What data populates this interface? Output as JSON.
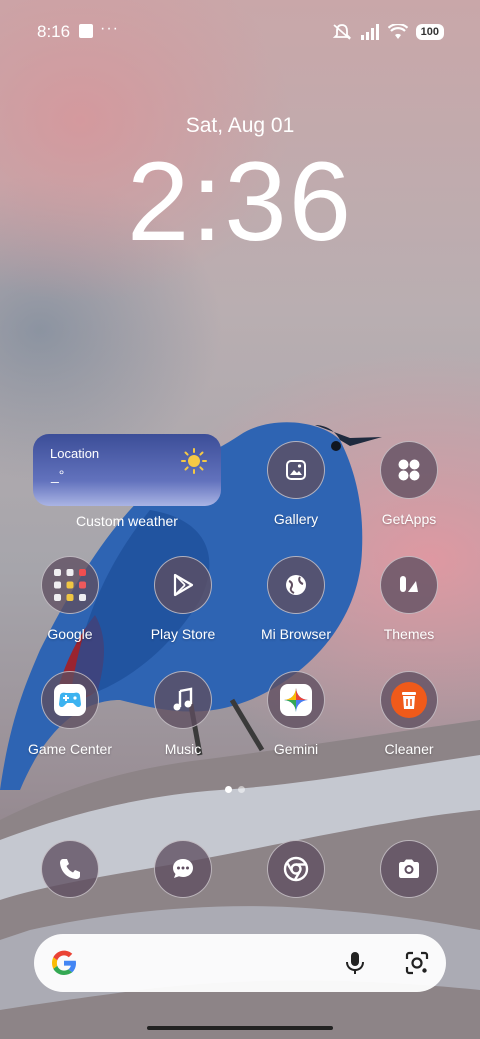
{
  "status_bar": {
    "time": "8:16",
    "overflow": "···",
    "battery": "100"
  },
  "lockscreen": {
    "date": "Sat, Aug 01",
    "time": "2:36"
  },
  "weather_widget": {
    "location": "Location",
    "temp": "_°",
    "label": "Custom weather"
  },
  "apps": {
    "gallery": "Gallery",
    "getapps": "GetApps",
    "google": "Google",
    "play_store": "Play Store",
    "mi_browser": "Mi Browser",
    "themes": "Themes",
    "game_center": "Game Center",
    "music": "Music",
    "gemini": "Gemini",
    "cleaner": "Cleaner"
  },
  "dock": [
    "phone-icon",
    "messages-icon",
    "chrome-icon",
    "camera-icon"
  ],
  "page_indicator": {
    "pages": 2,
    "active": 0
  }
}
